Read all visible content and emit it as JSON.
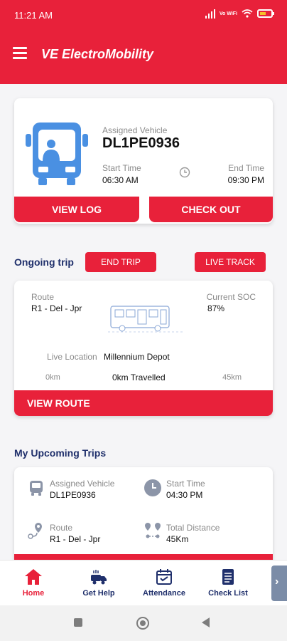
{
  "status_bar": {
    "time": "11:21 AM",
    "network": "Vo WiFi"
  },
  "header": {
    "title": "VE ElectroMobility"
  },
  "vehicle_card": {
    "assigned_label": "Assigned Vehicle",
    "assigned_value": "DL1PE0936",
    "start_label": "Start Time",
    "start_value": "06:30 AM",
    "end_label": "End Time",
    "end_value": "09:30 PM",
    "view_log_label": "VIEW LOG",
    "check_out_label": "CHECK OUT"
  },
  "ongoing": {
    "label": "Ongoing trip",
    "end_trip_label": "END TRIP",
    "live_track_label": "LIVE TRACK",
    "route_label": "Route",
    "route_value": "R1 - Del - Jpr",
    "soc_label": "Current SOC",
    "soc_value": "87%",
    "location_label": "Live Location",
    "location_value": "Millennium Depot",
    "km_start": "0km",
    "km_travelled": "0km Travelled",
    "km_end": "45km",
    "view_route_label": "VIEW ROUTE"
  },
  "upcoming": {
    "label": "My Upcoming Trips",
    "vehicle_label": "Assigned Vehicle",
    "vehicle_value": "DL1PE0936",
    "start_label": "Start Time",
    "start_value": "04:30 PM",
    "route_label": "Route",
    "route_value": "R1 - Del - Jpr",
    "distance_label": "Total Distance",
    "distance_value": "45Km"
  },
  "bottom_nav": {
    "items": [
      {
        "label": "Home",
        "icon": "home-icon",
        "active": true
      },
      {
        "label": "Get Help",
        "icon": "help-icon",
        "active": false
      },
      {
        "label": "Attendance",
        "icon": "attendance-icon",
        "active": false
      },
      {
        "label": "Check List",
        "icon": "checklist-icon",
        "active": false
      }
    ]
  },
  "colors": {
    "primary": "#e8213a",
    "navy": "#1f2f6b",
    "bus_blue": "#4a90e2"
  }
}
